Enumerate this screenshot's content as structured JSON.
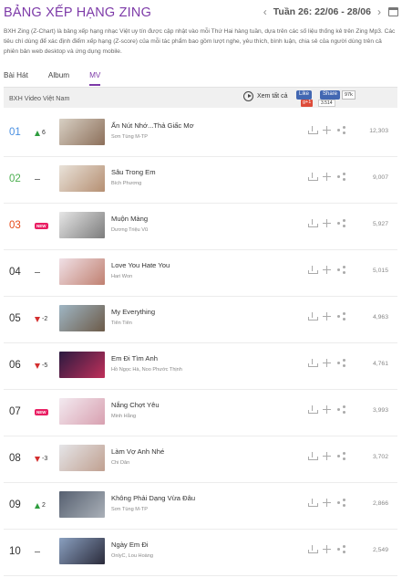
{
  "header": {
    "title": "BẢNG XẾP HẠNG ZING",
    "week_label": "Tuần 26: 22/06 - 28/06"
  },
  "description": "BXH Zing (Z-Chart) là bảng xếp hạng nhạc Việt uy tín được cập nhật vào mỗi Thứ Hai hàng tuần, dựa trên các số liệu thống kê trên Zing Mp3. Các tiêu chí dùng để xác định điểm xếp hạng (Z-score) của mỗi tác phẩm bao gồm lượt nghe, yêu thích, bình luận, chia sẻ của người dùng trên cả phiên bản web desktop và ứng dụng mobile.",
  "tabs": [
    {
      "label": "Bài Hát"
    },
    {
      "label": "Album"
    },
    {
      "label": "MV"
    }
  ],
  "subbar": {
    "label": "BXH Video Việt Nam",
    "play_all": "Xem tất cả",
    "fb_like": "Like",
    "fb_share": "Share",
    "fb_count": "97k",
    "gplus": "g+1",
    "gplus_count": "3.514"
  },
  "rows": [
    {
      "rank": "01",
      "status": "up",
      "change": "6",
      "song": "Ấn Nút Nhớ...Thả Giấc Mơ",
      "artist": "Sơn Tùng M-TP",
      "views": "12,303"
    },
    {
      "rank": "02",
      "status": "same",
      "change": "",
      "song": "Sâu Trong Em",
      "artist": "Bích Phương",
      "views": "9,007"
    },
    {
      "rank": "03",
      "status": "new",
      "change": "NEW",
      "song": "Muộn Màng",
      "artist": "Dương Triệu Vũ",
      "views": "5,927"
    },
    {
      "rank": "04",
      "status": "same",
      "change": "",
      "song": "Love You Hate You",
      "artist": "Hari Won",
      "views": "5,015"
    },
    {
      "rank": "05",
      "status": "down",
      "change": "2",
      "song": "My Everything",
      "artist": "Tiên Tiên",
      "views": "4,963"
    },
    {
      "rank": "06",
      "status": "down",
      "change": "5",
      "song": "Em Đi Tìm Anh",
      "artist": "Hồ Ngọc Hà, Noo Phước Thịnh",
      "views": "4,761"
    },
    {
      "rank": "07",
      "status": "new",
      "change": "NEW",
      "song": "Nắng Chợt Yêu",
      "artist": "Minh Hằng",
      "views": "3,993"
    },
    {
      "rank": "08",
      "status": "down",
      "change": "3",
      "song": "Làm Vợ Anh Nhé",
      "artist": "Chi Dân",
      "views": "3,702"
    },
    {
      "rank": "09",
      "status": "up",
      "change": "2",
      "song": "Không Phải Dạng Vừa Đâu",
      "artist": "Sơn Tùng M-TP",
      "views": "2,866"
    },
    {
      "rank": "10",
      "status": "same",
      "change": "",
      "song": "Ngày Em Đi",
      "artist": "OnlyC, Lou Hoàng",
      "views": "2,549"
    }
  ],
  "thumb_colors": [
    [
      "#d8d0c4",
      "#8c6f5a"
    ],
    [
      "#e9e2d9",
      "#b58f72"
    ],
    [
      "#e6e6e6",
      "#7c7c7c"
    ],
    [
      "#f0e0e6",
      "#c08070"
    ],
    [
      "#9fb6c4",
      "#6c5a48"
    ],
    [
      "#2b1a40",
      "#c0305a"
    ],
    [
      "#f3eaf0",
      "#d8a0b0"
    ],
    [
      "#e5e5e8",
      "#c0a090"
    ],
    [
      "#566070",
      "#aab0b8"
    ],
    [
      "#8aa0c0",
      "#2a2a3a"
    ]
  ],
  "colors": {
    "accent": "#7d3aa8",
    "rank1": "#4a90e2",
    "rank2": "#4caf50",
    "rank3": "#e64a19",
    "up": "#2e9d3e",
    "down": "#d32f2f",
    "new": "#e91e63"
  }
}
